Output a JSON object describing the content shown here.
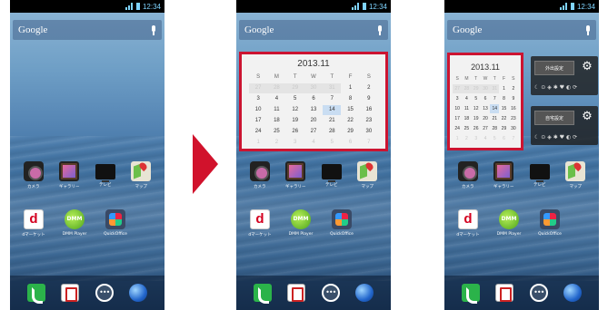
{
  "status_bar": {
    "time": "12:34"
  },
  "search_bar": {
    "label": "Google"
  },
  "home_apps_row1": [
    {
      "name": "カメラ",
      "icon": "camera-icon"
    },
    {
      "name": "ギャラリー",
      "icon": "gallery-icon"
    },
    {
      "name": "テレビ",
      "icon": "tv-icon"
    },
    {
      "name": "マップ",
      "icon": "map-icon"
    }
  ],
  "home_apps_row2": [
    {
      "name": "dマーケット",
      "icon": "dmarket-icon"
    },
    {
      "name": "DMM Player",
      "icon": "dmm-player-icon"
    },
    {
      "name": "QuickOffice",
      "icon": "quickoffice-icon"
    }
  ],
  "dock": [
    "phone-icon",
    "contacts-icon",
    "app-drawer-icon",
    "browser-globe-icon"
  ],
  "calendar_widget": {
    "month": "2013.11",
    "weekdays": [
      "S",
      "M",
      "T",
      "W",
      "T",
      "F",
      "S"
    ],
    "weeks": [
      [
        "27",
        "28",
        "29",
        "30",
        "31",
        "1",
        "2"
      ],
      [
        "3",
        "4",
        "5",
        "6",
        "7",
        "8",
        "9"
      ],
      [
        "10",
        "11",
        "12",
        "13",
        "14",
        "15",
        "16"
      ],
      [
        "17",
        "18",
        "19",
        "20",
        "21",
        "22",
        "23"
      ],
      [
        "24",
        "25",
        "26",
        "27",
        "28",
        "29",
        "30"
      ],
      [
        "1",
        "2",
        "3",
        "4",
        "5",
        "6",
        "7"
      ]
    ],
    "today": "14"
  },
  "mode_widgets": [
    {
      "label": "外出設定",
      "status": "☾ ⊙ ◈ ✱ ♥ ◐ ⟳"
    },
    {
      "label": "自宅設定",
      "status": "☾ ⊙ ◈ ✱ ♥ ◐ ⟳"
    }
  ],
  "colors": {
    "highlight_frame": "#cc1431",
    "arrow": "#d1122c"
  }
}
